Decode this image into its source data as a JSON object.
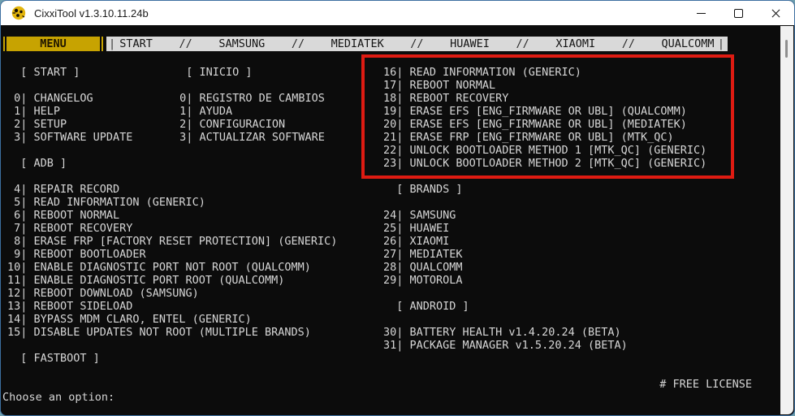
{
  "window": {
    "title": "CixxiTool v1.3.10.11.24b"
  },
  "menubar": {
    "active_tab": "MENU",
    "tabs": [
      "START",
      "SAMSUNG",
      "MEDIATEK",
      "HUAWEI",
      "XIAOMI",
      "QUALCOMM"
    ],
    "separator": "//",
    "pipe": "|"
  },
  "console": {
    "left_lines": [
      "  [ START ]",
      "",
      " 0| CHANGELOG",
      " 1| HELP",
      " 2| SETUP",
      " 3| SOFTWARE UPDATE",
      "",
      "  [ ADB ]",
      "",
      " 4| REPAIR RECORD",
      " 5| READ INFORMATION (GENERIC)",
      " 6| REBOOT NORMAL",
      " 7| REBOOT RECOVERY",
      " 8| ERASE FRP [FACTORY RESET PROTECTION] (GENERIC)",
      " 9| REBOOT BOOTLOADER",
      "10| ENABLE DIAGNOSTIC PORT NOT ROOT (QUALCOMM)",
      "11| ENABLE DIAGNOSTIC PORT ROOT (QUALCOMM)",
      "12| REBOOT DOWNLOAD (SAMSUNG)",
      "13| REBOOT SIDELOAD",
      "14| BYPASS MDM CLARO, ENTEL (GENERIC)",
      "15| DISABLE UPDATES NOT ROOT (MULTIPLE BRANDS)",
      "",
      "  [ FASTBOOT ]"
    ],
    "middle_lines": [
      "  [ INICIO ]",
      "",
      " 0| REGISTRO DE CAMBIOS",
      " 1| AYUDA",
      " 2| CONFIGURACION",
      " 3| ACTUALIZAR SOFTWARE"
    ],
    "right_lines": [
      "16| READ INFORMATION (GENERIC)",
      "17| REBOOT NORMAL",
      "18| REBOOT RECOVERY",
      "19| ERASE EFS [ENG_FIRMWARE OR UBL] (QUALCOMM)",
      "20| ERASE EFS [ENG_FIRMWARE OR UBL] (MEDIATEK)",
      "21| ERASE FRP [ENG_FIRMWARE OR UBL] (MTK_QC)",
      "22| UNLOCK BOOTLOADER METHOD 1 [MTK_QC] (GENERIC)",
      "23| UNLOCK BOOTLOADER METHOD 2 [MTK_QC] (GENERIC)",
      "",
      "  [ BRANDS ]",
      "",
      "24| SAMSUNG",
      "25| HUAWEI",
      "26| XIAOMI",
      "27| MEDIATEK",
      "28| QUALCOMM",
      "29| MOTOROLA",
      "",
      "  [ ANDROID ]",
      "",
      "30| BATTERY HEALTH v1.4.20.24 (BETA)",
      "31| PACKAGE MANAGER v1.5.20.24 (BETA)"
    ],
    "license_note": "# FREE LICENSE",
    "prompt": "Choose an option:"
  },
  "colors": {
    "accent_gold": "#C7A301",
    "tab_gray": "#D9D9D9",
    "console_bg": "#0C0C0C",
    "console_text": "#D6D6D6",
    "highlight_red": "#DE1B12"
  }
}
